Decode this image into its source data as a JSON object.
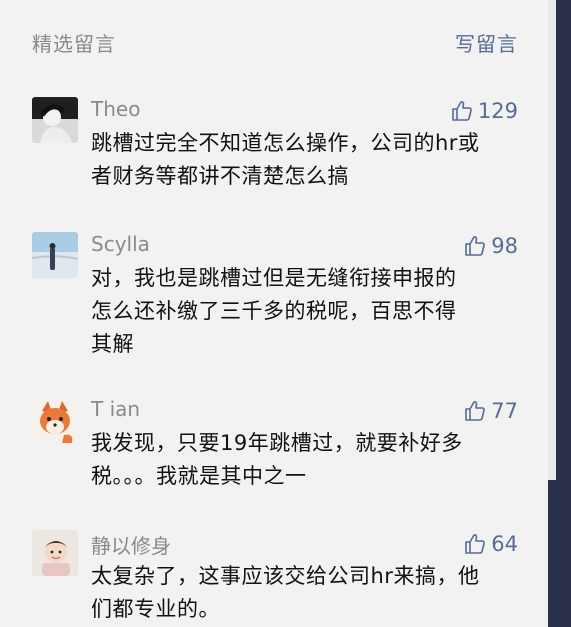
{
  "header": {
    "title": "精选留言",
    "write": "写留言"
  },
  "comments": [
    {
      "nick": "Theo",
      "likes": "129",
      "line1": "跳槽过完全不知道怎么操作，公司的hr或",
      "line2": "者财务等都讲不清楚怎么搞",
      "line3": ""
    },
    {
      "nick": "Scylla",
      "likes": "98",
      "line1": "对，我也是跳槽过但是无缝衔接申报的",
      "line2": "怎么还补缴了三千多的税呢，百思不得",
      "line3": "其解"
    },
    {
      "nick": "T ian",
      "likes": "77",
      "line1": "我发现，只要19年跳槽过，就要补好多",
      "line2": "税。。。我就是其中之一",
      "line3": ""
    },
    {
      "nick": "静以修身",
      "likes": "64",
      "line1": "太复杂了，这事应该交给公司hr来搞，他",
      "line2": "们都专业的。",
      "line3": ""
    }
  ],
  "colors": {
    "link": "#576b95",
    "meta": "#8a8a8a",
    "text": "#111111",
    "dark_bar": "#2a3049"
  }
}
